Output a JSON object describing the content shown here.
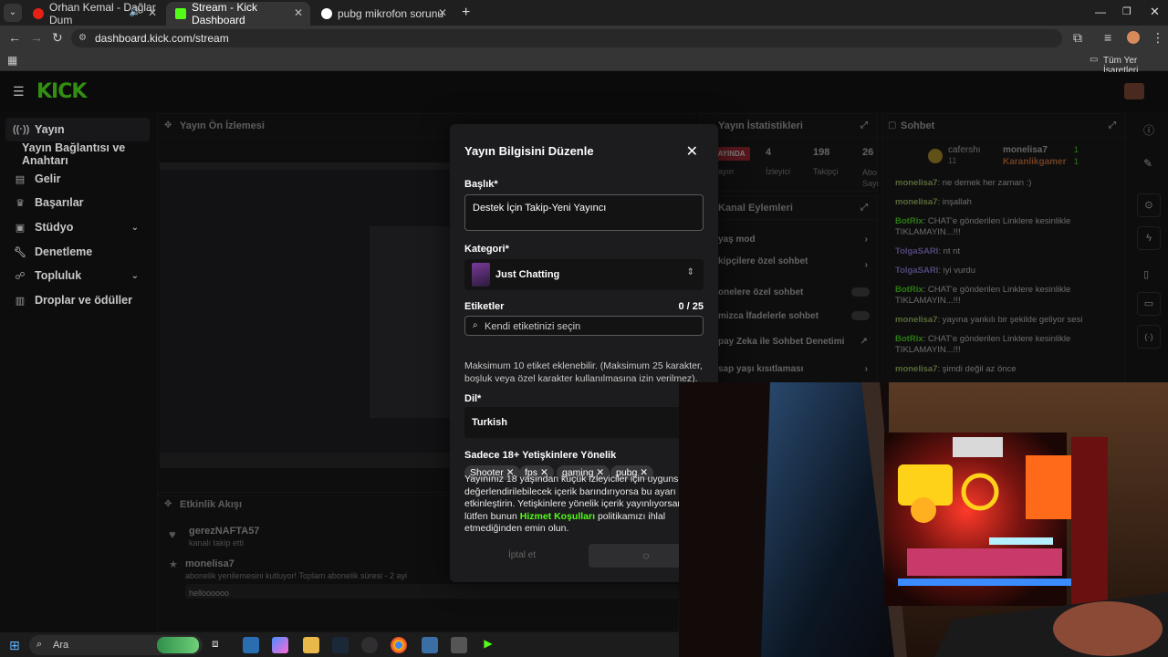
{
  "tabs": [
    {
      "title": "Orhan Kemal - Dağlar Dum",
      "favicon_color": "#e62117"
    },
    {
      "title": "Stream - Kick Dashboard",
      "favicon_color": "#53fc18"
    },
    {
      "title": "pubg mikrofon sorunu - Goog",
      "favicon_color": "#ffffff"
    }
  ],
  "url": "dashboard.kick.com/stream",
  "bookmarks": {
    "all_bookmarks": "Tüm Yer İşaretleri"
  },
  "brand": {
    "logo": "KICK",
    "accent": "#53fc18"
  },
  "sidebar": {
    "items": [
      {
        "label": "Yayın",
        "icon": "broadcast-icon"
      },
      {
        "label": "Yayın Bağlantısı ve Anahtarı"
      },
      {
        "label": "Gelir",
        "icon": "money-icon"
      },
      {
        "label": "Başarılar",
        "icon": "trophy-icon"
      },
      {
        "label": "Stüdyo",
        "icon": "studio-icon"
      },
      {
        "label": "Denetleme",
        "icon": "wrench-icon"
      },
      {
        "label": "Topluluk",
        "icon": "users-icon"
      },
      {
        "label": "Droplar ve ödüller",
        "icon": "gift-icon"
      }
    ]
  },
  "preview": {
    "title": "Yayın Ön İzlemesi"
  },
  "stats": {
    "title": "Yayın İstatistikleri",
    "live_badge": "YAYINDA",
    "viewers_value": "4",
    "viewers_label": "İzleyici",
    "followers_value": "198",
    "followers_label": "Takipçi",
    "subs_value": "26",
    "subs_label": "Abo Sayı",
    "partial_label": "ayın"
  },
  "channel_actions": {
    "title": "Kanal Eylemleri",
    "items": [
      "yaş mod",
      "kipçilere özel sohbet",
      "onelere özel sohbet",
      "mizca İfadelerle sohbet",
      "pay Zeka ile Sohbet Denetimi",
      "sap yaşı kısıtlaması"
    ]
  },
  "chat": {
    "title": "Sohbet",
    "top_gifter": "cafershı",
    "top_gifter_count": "11",
    "top_users": [
      "monelisa7",
      "Karanlikgamer"
    ],
    "top_counts": [
      "1",
      "1"
    ],
    "messages": [
      {
        "user": "monelisa7",
        "text": "ne demek her zaman :)",
        "user_color": "#b1d765"
      },
      {
        "user": "monelisa7",
        "text": "inşallah",
        "user_color": "#b1d765"
      },
      {
        "user": "BotRix",
        "text": "CHAT'e gönderilen Linklere kesinlikle TIKLAMAYIN...!!!",
        "user_color": "#53fc18"
      },
      {
        "user": "TolgaSARI",
        "text": "nt nt",
        "user_color": "#a78bfa"
      },
      {
        "user": "TolgaSARI",
        "text": "iyi vurdu",
        "user_color": "#a78bfa"
      },
      {
        "user": "BotRix",
        "text": "CHAT'e gönderilen Linklere kesinlikle TIKLAMAYIN...!!!",
        "user_color": "#53fc18"
      },
      {
        "user": "monelisa7",
        "text": "yayına yankılı bir şekilde geliyor sesi",
        "user_color": "#b1d765"
      },
      {
        "user": "BotRix",
        "text": "CHAT'e gönderilen Linklere kesinlikle TIKLAMAYIN...!!!",
        "user_color": "#53fc18"
      },
      {
        "user": "monelisa7",
        "text": "şimdi değil az önce",
        "user_color": "#b1d765"
      }
    ]
  },
  "activity": {
    "title": "Etkinlik Akışı",
    "events": [
      {
        "user": "gerezNAFTA57",
        "desc": "kanalı takip etti"
      },
      {
        "user": "monelisa7",
        "desc": "abonelik yenilemesini kutluyor! Toplam abonelik süresi - 2 ayi",
        "message": "helloooooo"
      }
    ]
  },
  "modal": {
    "title": "Yayın Bilgisini Düzenle",
    "title_label": "Başlık*",
    "title_value": "Destek İçin Takip-Yeni Yayıncı",
    "category_label": "Kategori*",
    "category_value": "Just Chatting",
    "tags_label": "Etiketler",
    "tags_count": "0 / 25",
    "tags_placeholder": "Kendi etiketinizi seçin",
    "tags": [
      "Shooter",
      "fps",
      "gaming",
      "pubg"
    ],
    "tags_help": "Maksimum 10 etiket eklenebilir. (Maksimum 25 karakter, boşluk veya özel karakter kullanılmasına izin verilmez).",
    "lang_label": "Dil*",
    "lang_value": "Turkish",
    "adult_label": "Sadece 18+ Yetişkinlere Yönelik",
    "adult_desc_1": "Yayınınız 18 yaşından küçük izleyiciler için uygunsuz o değerlendirilebilecek içerik barındırıyorsa bu ayarı etkinleştirin. Yetişkinlere yönelik içerik yayınlıyorsanız lütfen bunun",
    "adult_link": "Hizmet Koşulları",
    "adult_desc_2": "politikamızı ihlal etmediğinden emin olun.",
    "cancel_label": "İptal et"
  },
  "taskbar": {
    "search_placeholder": "Ara"
  }
}
